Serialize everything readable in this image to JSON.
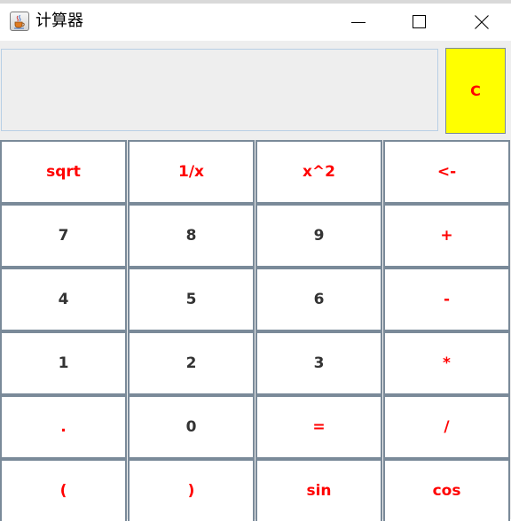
{
  "window": {
    "title": "计算器",
    "icon": "java-cup-icon",
    "controls": [
      "minimize-icon",
      "maximize-icon",
      "close-icon"
    ]
  },
  "display": {
    "value": ""
  },
  "clear_button": {
    "label": "C",
    "background": "#ffff00",
    "text_color": "#ff0000"
  },
  "colors": {
    "function_key_text": "#ff0000",
    "digit_key_text": "#333333",
    "key_border": "#7a8a99",
    "panel_background": "#eeeeee"
  },
  "keypad": {
    "rows": [
      [
        "sqrt",
        "1/x",
        "x^2",
        "<-"
      ],
      [
        "7",
        "8",
        "9",
        "+"
      ],
      [
        "4",
        "5",
        "6",
        "-"
      ],
      [
        "1",
        "2",
        "3",
        "*"
      ],
      [
        ".",
        "0",
        "=",
        "/"
      ],
      [
        "(",
        ")",
        "sin",
        "cos"
      ]
    ]
  }
}
